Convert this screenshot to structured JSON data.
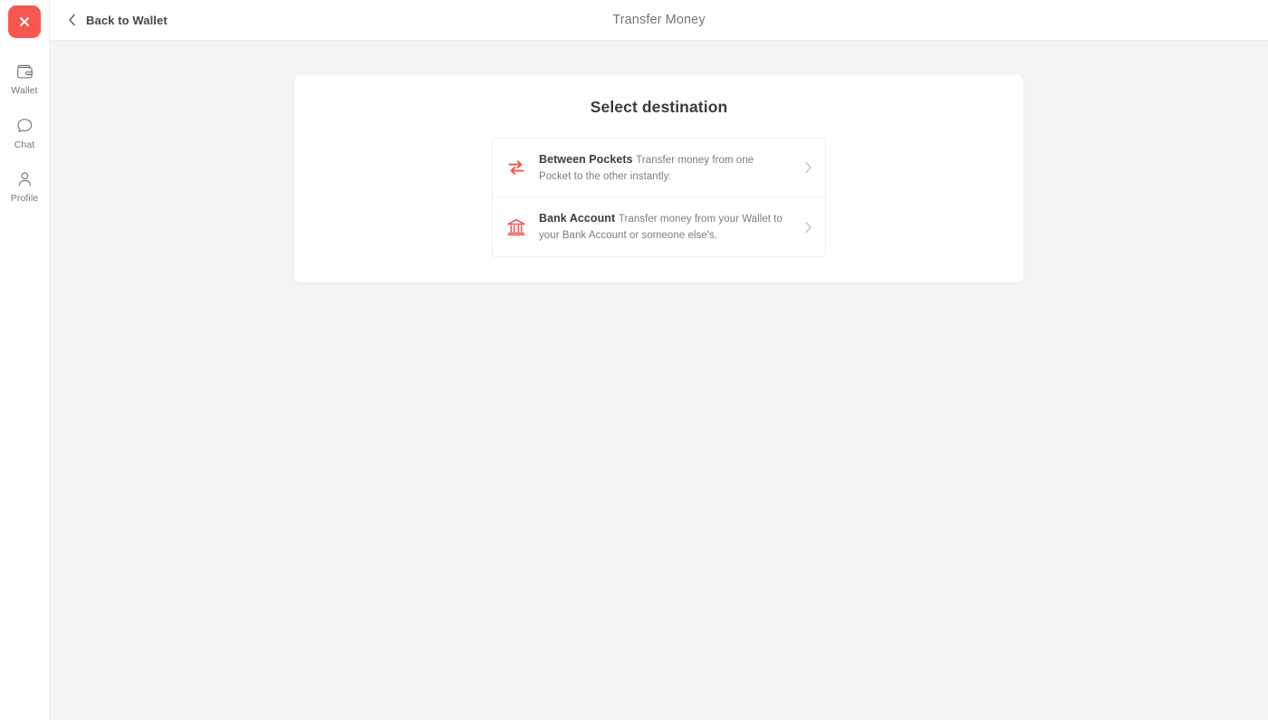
{
  "theme": {
    "accent": "#f8574f",
    "icon_red": "#f0534c",
    "page_bg": "#f4f4f5",
    "panel_bg": "#ffffff",
    "text_primary": "#3b3b40",
    "text_muted": "#7d7d83"
  },
  "sidebar": {
    "close_button": {
      "name": "close-button",
      "icon": "close-x-icon"
    },
    "items": [
      {
        "label": "Wallet",
        "icon": "wallet-icon"
      },
      {
        "label": "Chat",
        "icon": "chat-bubble-icon"
      },
      {
        "label": "Profile",
        "icon": "person-icon"
      }
    ]
  },
  "topbar": {
    "back_label": "Back to Wallet",
    "back_icon": "chevron-left-icon",
    "title": "Transfer Money"
  },
  "panel": {
    "title": "Select destination",
    "options": [
      {
        "title": "Between Pockets",
        "description": "Transfer money from one Pocket to the other instantly.",
        "icon": "transfer-arrows-icon",
        "chevron": "chevron-right-icon"
      },
      {
        "title": "Bank Account",
        "description": "Transfer money from your Wallet to your Bank Account or someone else's.",
        "icon": "bank-building-icon",
        "chevron": "chevron-right-icon"
      }
    ]
  }
}
